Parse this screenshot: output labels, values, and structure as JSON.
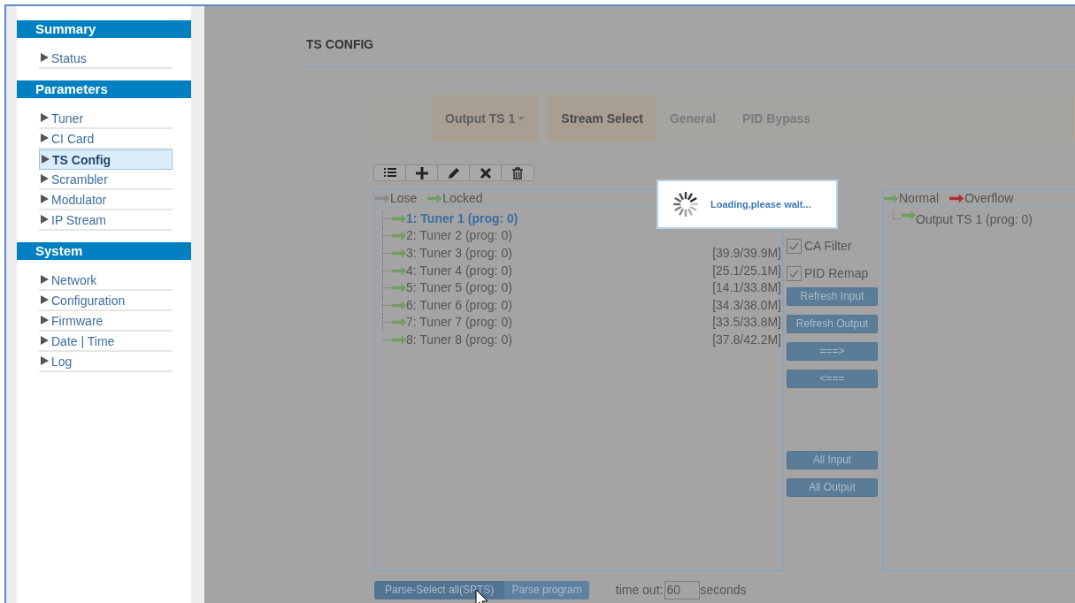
{
  "sidebar": {
    "sections": [
      {
        "title": "Summary",
        "items": [
          {
            "label": "Status",
            "selected": false
          }
        ]
      },
      {
        "title": "Parameters",
        "items": [
          {
            "label": "Tuner",
            "selected": false
          },
          {
            "label": "CI Card",
            "selected": false
          },
          {
            "label": "TS Config",
            "selected": true
          },
          {
            "label": "Scrambler",
            "selected": false
          },
          {
            "label": "Modulator",
            "selected": false
          },
          {
            "label": "IP Stream",
            "selected": false
          }
        ]
      },
      {
        "title": "System",
        "items": [
          {
            "label": "Network",
            "selected": false
          },
          {
            "label": "Configuration",
            "selected": false
          },
          {
            "label": "Firmware",
            "selected": false
          },
          {
            "label": "Date | Time",
            "selected": false
          },
          {
            "label": "Log",
            "selected": false
          }
        ]
      }
    ]
  },
  "page_title": "TS CONFIG",
  "tabs": [
    {
      "label": "Output TS 1",
      "kind": "dropdown",
      "selected": false
    },
    {
      "label": "Stream Select",
      "kind": "tab",
      "selected": true
    },
    {
      "label": "General",
      "kind": "tab",
      "selected": false
    },
    {
      "label": "PID Bypass",
      "kind": "tab",
      "selected": false
    }
  ],
  "input_panel": {
    "legend": [
      {
        "label": "Lose",
        "kind": "lose"
      },
      {
        "label": "Locked",
        "kind": "locked"
      }
    ],
    "items": [
      {
        "label": "1: Tuner 1 (prog: 0)",
        "selected": true
      },
      {
        "label": "2: Tuner 2 (prog: 0)",
        "selected": false
      },
      {
        "label": "3: Tuner 3 (prog: 0)",
        "selected": false,
        "rate": "[39.9/39.9M]"
      },
      {
        "label": "4: Tuner 4 (prog: 0)",
        "selected": false,
        "rate": "[25.1/25.1M]"
      },
      {
        "label": "5: Tuner 5 (prog: 0)",
        "selected": false,
        "rate": "[14.1/33.8M]"
      },
      {
        "label": "6: Tuner 6 (prog: 0)",
        "selected": false,
        "rate": "[34.3/38.0M]"
      },
      {
        "label": "7: Tuner 7 (prog: 0)",
        "selected": false,
        "rate": "[33.5/33.8M]"
      },
      {
        "label": "8: Tuner 8 (prog: 0)",
        "selected": false,
        "rate": "[37.8/42.2M]"
      }
    ]
  },
  "options": [
    {
      "label": "CA Filter",
      "checked": true
    },
    {
      "label": "PID Remap",
      "checked": true
    }
  ],
  "action_buttons": [
    "Refresh Input",
    "Refresh Output",
    "===>",
    "<==="
  ],
  "bulk_buttons": [
    "All Input",
    "All Output"
  ],
  "output_panel": {
    "legend": [
      {
        "label": "Normal",
        "kind": "normal"
      },
      {
        "label": "Overflow",
        "kind": "overflow"
      }
    ],
    "items": [
      {
        "label": "Output TS 1 (prog: 0)"
      }
    ]
  },
  "parse_buttons": [
    {
      "label": "Parse-Select all(SPTS)",
      "hovered": true
    },
    {
      "label": "Parse program",
      "hovered": false
    }
  ],
  "timeout": {
    "label": "time out:",
    "value": "60",
    "unit": "seconds"
  },
  "loading": {
    "text": "Loading,please wait..."
  }
}
